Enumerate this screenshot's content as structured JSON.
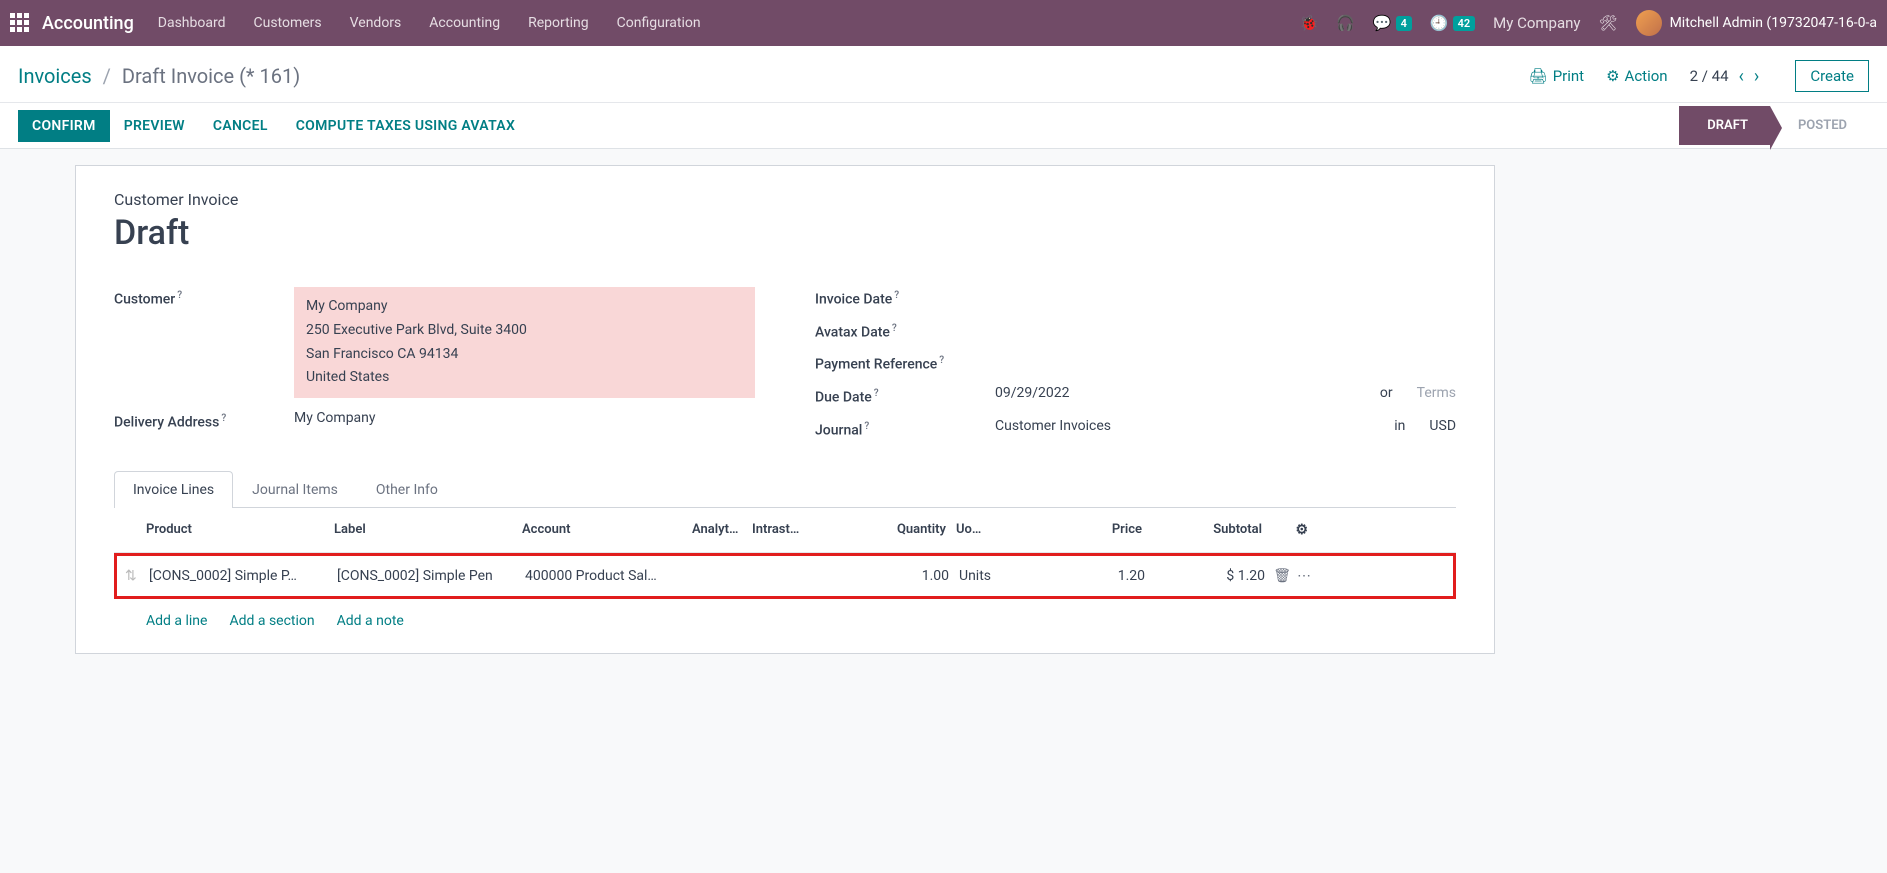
{
  "topbar": {
    "brand": "Accounting",
    "menu": [
      "Dashboard",
      "Customers",
      "Vendors",
      "Accounting",
      "Reporting",
      "Configuration"
    ],
    "messages_badge": "4",
    "activities_badge": "42",
    "company": "My Company",
    "user": "Mitchell Admin (19732047-16-0-a"
  },
  "breadcrumb": {
    "root": "Invoices",
    "current": "Draft Invoice (* 161)"
  },
  "controls": {
    "print": "Print",
    "action": "Action",
    "pager": "2 / 44",
    "create": "Create"
  },
  "statusbar": {
    "confirm": "CONFIRM",
    "preview": "PREVIEW",
    "cancel": "CANCEL",
    "compute": "COMPUTE TAXES USING AVATAX",
    "draft": "DRAFT",
    "posted": "POSTED"
  },
  "doc": {
    "label": "Customer Invoice",
    "title": "Draft"
  },
  "fields": {
    "customer_label": "Customer",
    "customer_name": "My Company",
    "customer_street": "250 Executive Park Blvd, Suite 3400",
    "customer_city": "San Francisco CA 94134",
    "customer_country": "United States",
    "delivery_label": "Delivery Address",
    "delivery_value": "My Company",
    "invoice_date_label": "Invoice Date",
    "avatax_date_label": "Avatax Date",
    "payment_ref_label": "Payment Reference",
    "due_date_label": "Due Date",
    "due_date_value": "09/29/2022",
    "or": "or",
    "terms_ph": "Terms",
    "journal_label": "Journal",
    "journal_value": "Customer Invoices",
    "in": "in",
    "currency": "USD"
  },
  "tabs": {
    "lines": "Invoice Lines",
    "journal": "Journal Items",
    "other": "Other Info"
  },
  "table": {
    "headers": {
      "product": "Product",
      "label": "Label",
      "account": "Account",
      "analytic": "Analyt…",
      "intrastat": "Intrast…",
      "qty": "Quantity",
      "uom": "Uo…",
      "price": "Price",
      "subtotal": "Subtotal"
    },
    "row": {
      "product": "[CONS_0002] Simple P…",
      "label": "[CONS_0002] Simple Pen",
      "account": "400000 Product Sal…",
      "qty": "1.00",
      "uom": "Units",
      "price": "1.20",
      "subtotal": "$ 1.20"
    },
    "adders": {
      "line": "Add a line",
      "section": "Add a section",
      "note": "Add a note"
    }
  }
}
